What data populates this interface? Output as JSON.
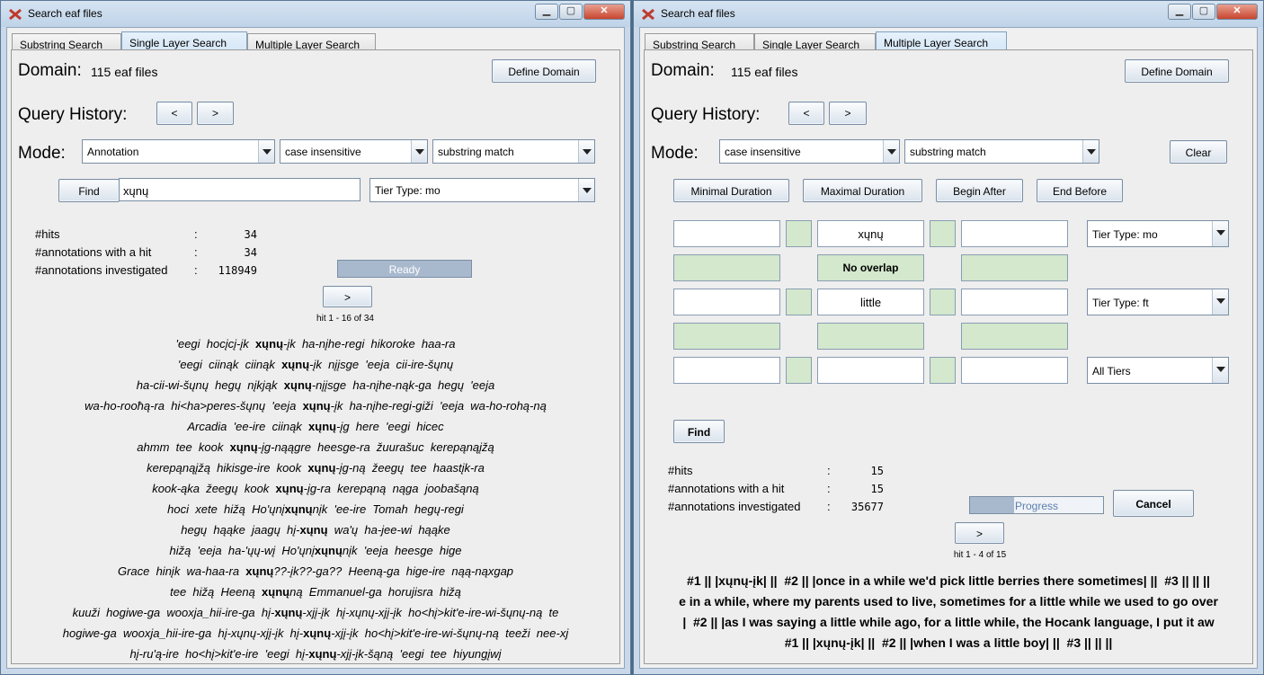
{
  "left": {
    "title": "Search eaf files",
    "tabs": [
      "Substring Search",
      "Single Layer Search",
      "Multiple Layer Search"
    ],
    "domain_label": "Domain:",
    "domain_value": "115 eaf files",
    "define_domain": "Define Domain",
    "query_history": "Query History:",
    "prev": "<",
    "next": ">",
    "mode_label": "Mode:",
    "mode_annotation": "Annotation",
    "mode_case": "case insensitive",
    "mode_match": "substring match",
    "find": "Find",
    "query_value": "xųnų",
    "tier_type": "Tier Type: mo",
    "stats": [
      {
        "label": "#hits",
        "value": "34"
      },
      {
        "label": "#annotations with a hit",
        "value": "34"
      },
      {
        "label": "#annotations investigated",
        "value": "118949"
      }
    ],
    "colon": ":",
    "status": "Ready",
    "page_next": ">",
    "hit_range": "hit 1 - 16 of 34",
    "kwic": [
      {
        "pre": "'eegi  hocįcį-įk  ",
        "hit": "xųnų",
        "post": "-įk  ha-nįhe-regi  hikoroke  haa-ra"
      },
      {
        "pre": "'eegi  ciinąk  ciinąk  ",
        "hit": "xųnų",
        "post": "-įk  nįįsge  'eeja  cii-ire-šųnų"
      },
      {
        "pre": "ha-cii-wi-šųnų  hegų  nįkjąk  ",
        "hit": "xųnų",
        "post": "-nįįsge  ha-nįhe-nąk-ga  hegų  'eeja"
      },
      {
        "pre": "wa-ho-rooħą-ra  hi<ha>peres-šųnų  'eeja  ",
        "hit": "xųnų",
        "post": "-įk  ha-nįhe-regi-giži  'eeja  wa-ho-rohą-ną"
      },
      {
        "pre": "Arcadia  'ee-ire  ciinąk  ",
        "hit": "xųnų",
        "post": "-įg  here  'eegi  hicec"
      },
      {
        "pre": "ahmm  tee  kook  ",
        "hit": "xųnų",
        "post": "-įg-nąągre  heesge-ra  žuurašuc  kerepąnąįžą"
      },
      {
        "pre": "kerepąnąįžą  hikisge-ire  kook  ",
        "hit": "xųnų",
        "post": "-įg-ną  žeegų  tee  haastįk-ra"
      },
      {
        "pre": "kook-ąka  žeegų  kook  ",
        "hit": "xųnų",
        "post": "-įg-ra  kerepąną  nąga  joobašąną"
      },
      {
        "pre": "hoci  xete  hižą  Ho'ųnį",
        "hit": "xųnų",
        "post": "nįk  'ee-ire  Tomah  hegų-regi"
      },
      {
        "pre": "hegų  hąąke  jaagų  hį-",
        "hit": "xųnų",
        "post": "  wa'ų  ha-jee-wi  hąąke"
      },
      {
        "pre": "hižą  'eeja  ha-'ųų-wį  Ho'ųnį",
        "hit": "xųnų",
        "post": "nįk  'eeja  heesge  hige"
      },
      {
        "pre": "Grace  hinįk  wa-haa-ra  ",
        "hit": "xųnų",
        "post": "??-įk??-ga??  Heeną-ga  hige-ire  nąą-nąxgap"
      },
      {
        "pre": "tee  hižą  Heeną  ",
        "hit": "xųnų",
        "post": "ną  Emmanuel-ga  horujisra  hižą"
      },
      {
        "pre": "kuuži  hogiwe-ga  wooxja_hii-ire-ga  hį-",
        "hit": "xųnų",
        "post": "-xjį-įk  hį-xųnų-xjį-įk  ho<hį>kit'e-ire-wi-šųnų-ną  te"
      },
      {
        "pre": "hogiwe-ga  wooxja_hii-ire-ga  hį-xųnų-xjį-įk  hį-",
        "hit": "xųnų",
        "post": "-xjį-įk  ho<hį>kit'e-ire-wi-šųnų-ną  teeži  nee-xj"
      },
      {
        "pre": "hį-ru'ą-ire  ho<hį>kit'e-ire  'eegi  hį-",
        "hit": "xųnų",
        "post": "-xjį-įk-šąną  'eegi  tee  hiyungįwį"
      }
    ]
  },
  "right": {
    "title": "Search eaf files",
    "tabs": [
      "Substring Search",
      "Single Layer Search",
      "Multiple Layer Search"
    ],
    "domain_label": "Domain:",
    "domain_value": "115 eaf files",
    "define_domain": "Define Domain",
    "query_history": "Query History:",
    "prev": "<",
    "next": ">",
    "mode_label": "Mode:",
    "mode_case": "case insensitive",
    "mode_match": "substring match",
    "clear": "Clear",
    "constraints": [
      "Minimal Duration",
      "Maximal Duration",
      "Begin After",
      "End Before"
    ],
    "grid_q1": "xųnų",
    "grid_rel": "No overlap",
    "grid_q2": "little",
    "tier1": "Tier Type: mo",
    "tier2": "Tier Type: ft",
    "tier3": "All Tiers",
    "find": "Find",
    "stats": [
      {
        "label": "#hits",
        "value": "15"
      },
      {
        "label": "#annotations with a hit",
        "value": "15"
      },
      {
        "label": "#annotations investigated",
        "value": "35677"
      }
    ],
    "colon": ":",
    "status": "Progress",
    "progress": 0.33,
    "cancel": "Cancel",
    "page_next": ">",
    "hit_range": "hit 1 - 4 of 15",
    "results": [
      "#1 || |xųnų-įk| ||  #2 || |once in a while we'd pick little berries there sometimes| ||  #3 || || ||",
      "e in a while, where my parents used to live, sometimes for a little while we used to go over",
      "|  #2 || |as I was saying a little while ago, for a little while, the Hocank language, I put it aw",
      "#1 || |xųnų-įk| ||  #2 || |when I was a little boy| ||  #3 || || ||"
    ]
  },
  "colors": {
    "accent": "#7fa0c2",
    "green_cell": "#d3e8cc",
    "progress": "#a8b9ce"
  }
}
